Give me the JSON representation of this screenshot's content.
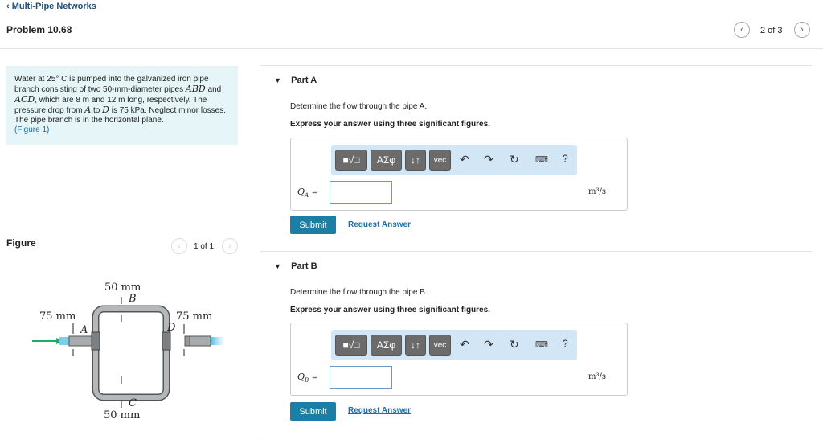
{
  "header": {
    "back_label": "Multi-Pipe Networks",
    "problem_title": "Problem 10.68",
    "pager": "2 of 3"
  },
  "problem": {
    "text_1": "Water at 25° C is pumped into the galvanized iron pipe branch consisting of two 50-mm-diameter pipes ",
    "abd": "ABD",
    "text_2": " and ",
    "acd": "ACD",
    "text_3": ", which are 8 m and 12 m long, respectively. The pressure drop from ",
    "a": "A",
    "text_4": " to ",
    "d": "D",
    "text_5": " is 75 kPa. Neglect minor losses. The pipe branch is in the horizontal plane.",
    "figure_link": "(Figure 1)"
  },
  "figure": {
    "heading": "Figure",
    "pager": "1 of 1",
    "labels": {
      "top": "50 mm",
      "b": "B",
      "left": "75 mm",
      "a": "A",
      "right": "75 mm",
      "d": "D",
      "c": "C",
      "bottom": "50 mm"
    }
  },
  "toolbar": {
    "templates": "■√□",
    "greek": "ΑΣφ",
    "arrows": "↓↑",
    "vec": "vec",
    "help": "?"
  },
  "parts": [
    {
      "title": "Part A",
      "question": "Determine the flow through the pipe A.",
      "instruction": "Express your answer using three significant figures.",
      "var": "Q",
      "sub": "A",
      "eq": "=",
      "value": "",
      "units": "m³/s",
      "submit": "Submit",
      "request": "Request Answer"
    },
    {
      "title": "Part B",
      "question": "Determine the flow through the pipe B.",
      "instruction": "Express your answer using three significant figures.",
      "var": "Q",
      "sub": "B",
      "eq": "=",
      "value": "",
      "units": "m³/s",
      "submit": "Submit",
      "request": "Request Answer"
    }
  ]
}
